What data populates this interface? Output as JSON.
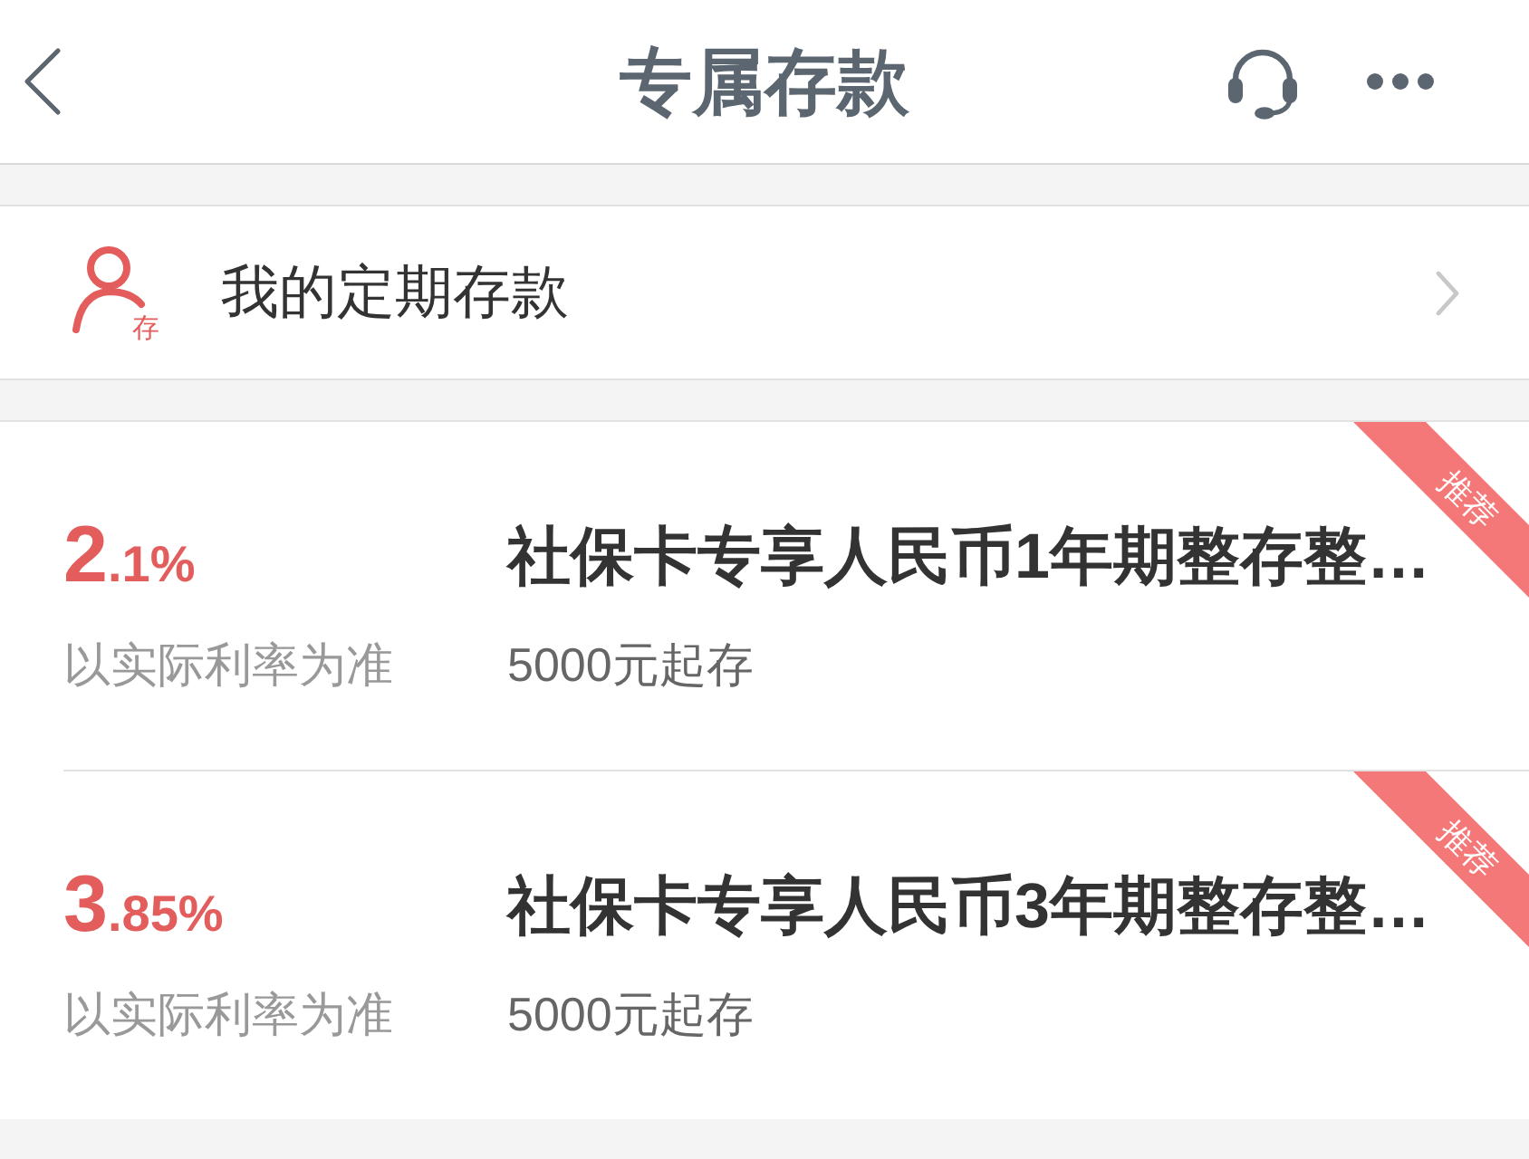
{
  "header": {
    "title": "专属存款"
  },
  "my_deposits": {
    "icon_label": "存",
    "label": "我的定期存款"
  },
  "products": [
    {
      "rate_whole": "2",
      "rate_fraction": ".1%",
      "rate_note": "以实际利率为准",
      "name": "社保卡专享人民币1年期整存整…",
      "minimum": "5000元起存",
      "ribbon": "推荐"
    },
    {
      "rate_whole": "3",
      "rate_fraction": ".85%",
      "rate_note": "以实际利率为准",
      "name": "社保卡专享人民币3年期整存整…",
      "minimum": "5000元起存",
      "ribbon": "推荐"
    }
  ]
}
